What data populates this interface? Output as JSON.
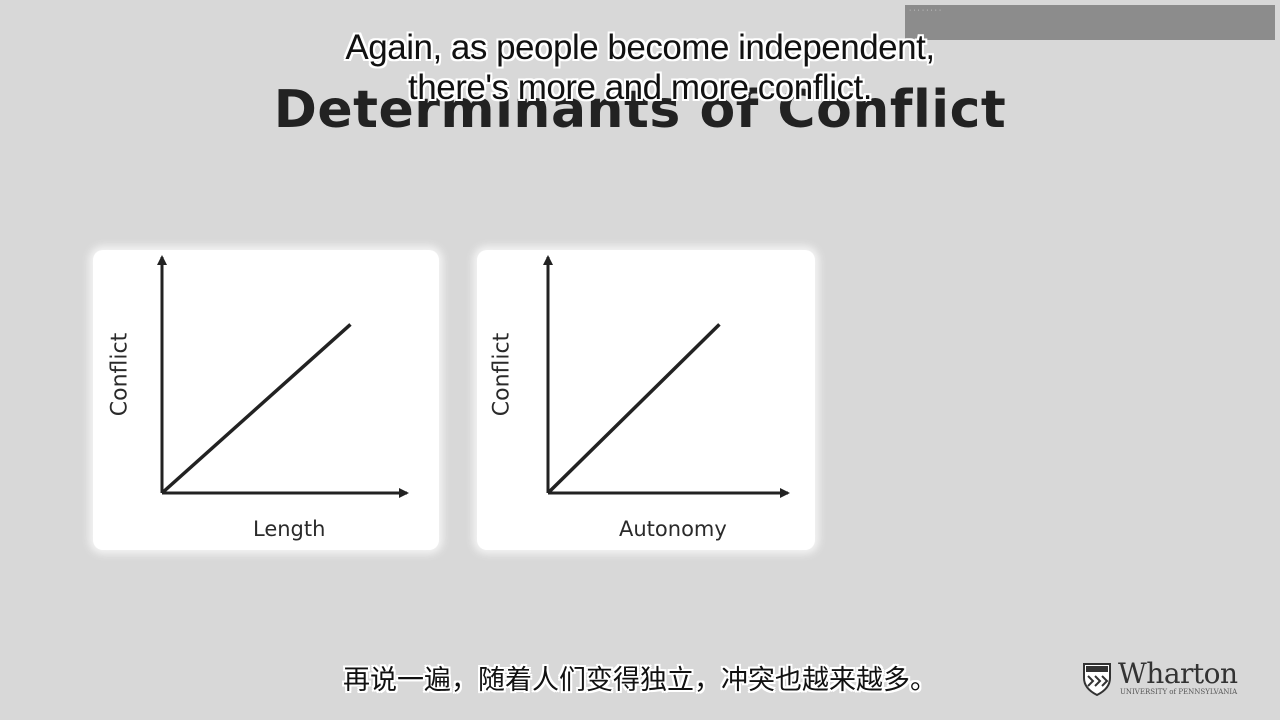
{
  "overlay": {
    "top_bar_text": "· · ·  · · · · ·"
  },
  "subtitles": {
    "english_lines": [
      "Again, as people become independent,",
      "there's more and more conflict."
    ],
    "chinese": "再说一遍，随着人们变得独立，冲突也越来越多。"
  },
  "slide": {
    "title": "Determinants of Conflict"
  },
  "logo": {
    "name": "Wharton",
    "subtext": "UNIVERSITY of PENNSYLVANIA"
  },
  "colors": {
    "background": "#d8d8d8",
    "card": "#ffffff",
    "ink": "#222222"
  },
  "chart_data": [
    {
      "type": "line",
      "xlabel": "Length",
      "ylabel": "Conflict",
      "x": [
        0,
        1
      ],
      "y": [
        0,
        1
      ],
      "xlim": [
        0,
        1.3
      ],
      "ylim": [
        0,
        1.4
      ],
      "grid": false
    },
    {
      "type": "line",
      "xlabel": "Autonomy",
      "ylabel": "Conflict",
      "x": [
        0,
        1
      ],
      "y": [
        0,
        1
      ],
      "xlim": [
        0,
        1.4
      ],
      "ylim": [
        0,
        1.4
      ],
      "grid": false
    }
  ]
}
